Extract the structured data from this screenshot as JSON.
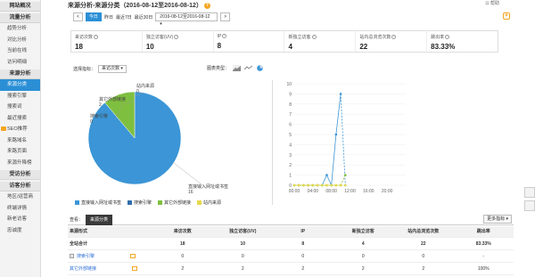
{
  "sidebar": {
    "sections": [
      {
        "title": "网站概况",
        "items": []
      },
      {
        "title": "流量分析",
        "items": [
          {
            "label": "趋势分析"
          },
          {
            "label": "对比分析"
          },
          {
            "label": "当前在线"
          },
          {
            "label": "访问明细"
          }
        ]
      },
      {
        "title": "来源分析",
        "items": [
          {
            "label": "来源分类",
            "active": true
          },
          {
            "label": "搜索引擎"
          },
          {
            "label": "搜索词"
          },
          {
            "label": "最近搜索"
          },
          {
            "label": "SEO推荐",
            "badge": true
          },
          {
            "label": "来路域名"
          },
          {
            "label": "来路页面"
          },
          {
            "label": "来源升降榜"
          }
        ]
      },
      {
        "title": "受访分析",
        "items": []
      },
      {
        "title": "访客分析",
        "items": [
          {
            "label": "地区/运营商"
          },
          {
            "label": "终端详情"
          },
          {
            "label": "新老访客"
          },
          {
            "label": "忠诚度"
          }
        ]
      }
    ]
  },
  "header": {
    "title": "来源分析-来源分类（2016-08-12至2016-08-12）",
    "help": "?",
    "top_right": "⊡ 帮助"
  },
  "toolbar": {
    "prev": "<",
    "today": "今日",
    "yesterday": "昨日",
    "last7": "最近7日",
    "last30": "最近30日",
    "date_range": "2016-08-12至2016-08-12",
    "date_arrow": "▾",
    "next": ">"
  },
  "stats": [
    {
      "label": "来访次数",
      "value": "18"
    },
    {
      "label": "独立访客(UV)",
      "value": "10"
    },
    {
      "label": "IP",
      "value": "8"
    },
    {
      "label": "新独立访客",
      "value": "4"
    },
    {
      "label": "站内总浏览次数",
      "value": "22"
    },
    {
      "label": "跳出率",
      "value": "83.33%"
    }
  ],
  "selector": {
    "label": "选择指标：",
    "value": "来访次数 ▾",
    "chart_type_label": "图表类型："
  },
  "pie": {
    "labels": [
      {
        "name": "站内来源",
        "value": "0"
      },
      {
        "name": "其它外部链接",
        "value": "2"
      },
      {
        "name": "搜索引擎",
        "value": "0"
      },
      {
        "name": "直接输入网址或书签",
        "value": "16"
      }
    ]
  },
  "chart_data": [
    {
      "type": "pie",
      "categories": [
        "直接输入网址或书签",
        "搜索引擎",
        "其它外部链接",
        "站内来源"
      ],
      "values": [
        16,
        0,
        2,
        0
      ],
      "colors": [
        "#3b95d6",
        "#2f6fae",
        "#7fbf3f",
        "#e8d84a"
      ]
    },
    {
      "type": "line",
      "x": [
        "00:00",
        "01:00",
        "02:00",
        "03:00",
        "04:00",
        "05:00",
        "06:00",
        "07:00",
        "08:00",
        "09:00",
        "10:00",
        "11:00",
        "12:00"
      ],
      "xticks": [
        "00:00",
        "04:00",
        "08:00",
        "12:00",
        "16:00",
        "20:00"
      ],
      "ylim": [
        0,
        10
      ],
      "yticks": [
        0,
        1,
        2,
        3,
        4,
        5,
        6,
        7,
        8,
        9,
        10
      ],
      "series": [
        {
          "name": "直接输入网址或书签",
          "color": "#3b95d6",
          "values": [
            0,
            0,
            0,
            0,
            0,
            0,
            0,
            1,
            0,
            5,
            9,
            0,
            null
          ]
        },
        {
          "name": "其它外部链接",
          "color": "#7fbf3f",
          "values": [
            0,
            0,
            0,
            0,
            0,
            0,
            0,
            0,
            0,
            0,
            0,
            1,
            null
          ]
        },
        {
          "name": "站内来源",
          "color": "#e8d84a",
          "values": [
            0,
            0,
            0,
            0,
            0,
            0,
            0,
            0,
            0,
            0,
            0,
            0,
            null
          ]
        }
      ]
    }
  ],
  "legend": [
    {
      "name": "直接输入网址或书签",
      "color": "#3b95d6"
    },
    {
      "name": "搜索引擎",
      "color": "#2f6fae"
    },
    {
      "name": "其它外部链接",
      "color": "#7fbf3f"
    },
    {
      "name": "站内来源",
      "color": "#e8d84a"
    }
  ],
  "tabs": {
    "look": "查看：",
    "active": "来源分类",
    "more": "更多指标 ▾"
  },
  "table": {
    "headers": [
      "来源形式",
      "来访次数",
      "独立访客(UV)",
      "IP",
      "新独立访客",
      "站内总浏览次数",
      "跳出率"
    ],
    "rows": [
      {
        "name": "全站合计",
        "vals": [
          "18",
          "10",
          "8",
          "4",
          "22",
          "83.33%"
        ],
        "total": true
      },
      {
        "name": "搜索引擎",
        "vals": [
          "0",
          "0",
          "0",
          "0",
          "0",
          "-"
        ],
        "link": true,
        "plus": "+"
      },
      {
        "name": "其它外部链接",
        "vals": [
          "2",
          "2",
          "2",
          "2",
          "2",
          "100%"
        ],
        "link": true
      }
    ]
  }
}
